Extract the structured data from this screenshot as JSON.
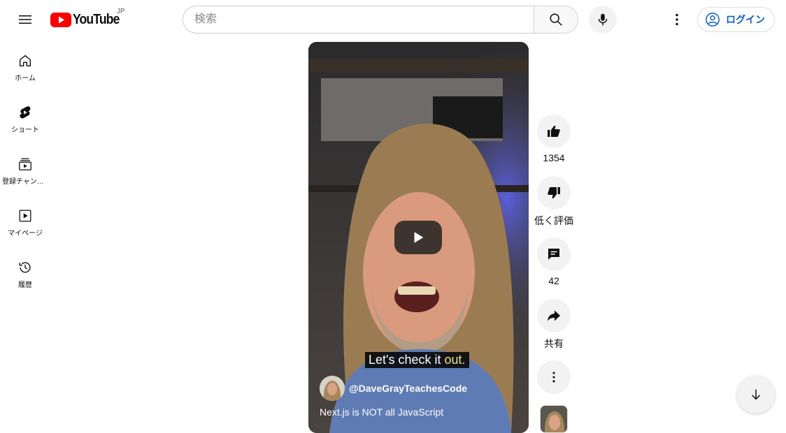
{
  "header": {
    "logo_text": "YouTube",
    "region": "JP",
    "search_placeholder": "検索",
    "signin_label": "ログイン"
  },
  "sidebar": {
    "items": [
      {
        "label": "ホーム",
        "icon": "home-icon"
      },
      {
        "label": "ショート",
        "icon": "shorts-icon"
      },
      {
        "label": "登録チャンネル",
        "icon": "subscriptions-icon"
      },
      {
        "label": "マイページ",
        "icon": "library-icon"
      },
      {
        "label": "履歴",
        "icon": "history-icon"
      }
    ]
  },
  "video": {
    "caption_main": "Let's check it ",
    "caption_highlight": "out.",
    "channel": "@DaveGrayTeachesCode",
    "title": "Next.js is NOT all JavaScript"
  },
  "actions": {
    "like_count": "1354",
    "dislike_label": "低く評価",
    "comments_count": "42",
    "share_label": "共有"
  },
  "colors": {
    "brand_red": "#ff0000",
    "link_blue": "#065fd4",
    "caption_highlight": "#f2e26b"
  }
}
